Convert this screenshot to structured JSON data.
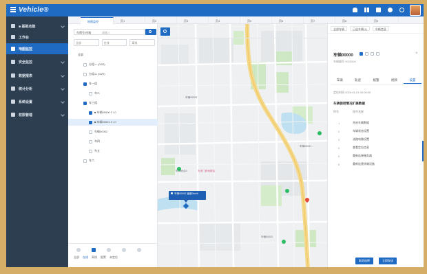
{
  "app": {
    "brand": "Vehicle®"
  },
  "topbar": {
    "icons": [
      "bell-icon",
      "grid-icon",
      "message-icon",
      "gear-icon",
      "user-icon"
    ],
    "avatar": "avatar"
  },
  "sidebar": {
    "items": [
      {
        "label": "■ 基础功能",
        "active": false
      },
      {
        "label": "工作台",
        "active": false
      },
      {
        "label": "地图监控",
        "active": true
      },
      {
        "label": "安全监控",
        "active": false
      },
      {
        "label": "数据报表",
        "active": false
      },
      {
        "label": "统计分析",
        "active": false
      },
      {
        "label": "系统设置",
        "active": false
      },
      {
        "label": "权限管理",
        "active": false
      }
    ]
  },
  "tabs": {
    "items": [
      "地图监控",
      "页1",
      "页2",
      "页3",
      "页4",
      "页5",
      "页6",
      "页7",
      "页8",
      "页9"
    ]
  },
  "leftpanel": {
    "search_value": "车牌号/终端",
    "search_placeholder": "请输入",
    "filters": [
      "全部",
      "在线",
      "离线"
    ],
    "tree": [
      {
        "label": "全部",
        "indent": 0,
        "box": "none",
        "sel": false
      },
      {
        "label": "分组一 (0/20)",
        "indent": 8,
        "box": "empty",
        "sel": false
      },
      {
        "label": "分组二 (0/20)",
        "indent": 8,
        "box": "empty",
        "sel": false
      },
      {
        "label": "车一组",
        "indent": 8,
        "box": "blue",
        "sel": false
      },
      {
        "label": "车二",
        "indent": 16,
        "box": "empty",
        "sel": false
      },
      {
        "label": "车三组",
        "indent": 8,
        "box": "blue",
        "sel": false
      },
      {
        "label": "■ 车辆00000  0 / 0",
        "indent": 16,
        "box": "blue",
        "sel": false
      },
      {
        "label": "■ 车辆00001  0 / 0",
        "indent": 16,
        "box": "blue",
        "sel": true
      },
      {
        "label": "车辆00002",
        "indent": 16,
        "box": "empty",
        "sel": false
      },
      {
        "label": "车四",
        "indent": 16,
        "box": "empty",
        "sel": false
      },
      {
        "label": "车五",
        "indent": 16,
        "box": "empty",
        "sel": false
      },
      {
        "label": "车六",
        "indent": 8,
        "box": "empty",
        "sel": false
      }
    ],
    "bottom_labels": [
      "全部",
      "在线",
      "离线",
      "报警",
      "未定位"
    ]
  },
  "map": {
    "car_label": "车辆00000 速度0km/h",
    "labels": [
      {
        "text": "车辆地点A",
        "cls": ""
      },
      {
        "text": "天安门西地铁站",
        "cls": "pink"
      },
      {
        "text": "车辆00001",
        "cls": ""
      },
      {
        "text": "车辆00002",
        "cls": ""
      },
      {
        "text": "车辆00003",
        "cls": ""
      }
    ]
  },
  "rightpanel": {
    "top_buttons": [
      "全部车辆",
      "已选车辆(1)",
      "车辆信息"
    ],
    "badge": "(1)",
    "title": "车辆00000",
    "subtitle": "车辆编号 0000000",
    "close": "×",
    "tabs": [
      "车辆",
      "轨迹",
      "报警",
      "视频",
      "设置"
    ],
    "active_tab": 4,
    "time": "定位时间 2020-01-01 00:00:00",
    "section_title": "车辆使用情况扩展数据",
    "table_head": [
      "序号",
      "指令名称"
    ],
    "rows": [
      {
        "num": "1",
        "name": "开启车辆数据"
      },
      {
        "num": "2",
        "name": "车辆状态设置"
      },
      {
        "num": "3",
        "name": "油路电路设置"
      },
      {
        "num": "4",
        "name": "查看定位信息"
      },
      {
        "num": "5",
        "name": "重新连接服务器"
      },
      {
        "num": "6",
        "name": "重新连接终端设备"
      }
    ],
    "buttons": [
      "取消选择",
      "立即发送"
    ]
  }
}
